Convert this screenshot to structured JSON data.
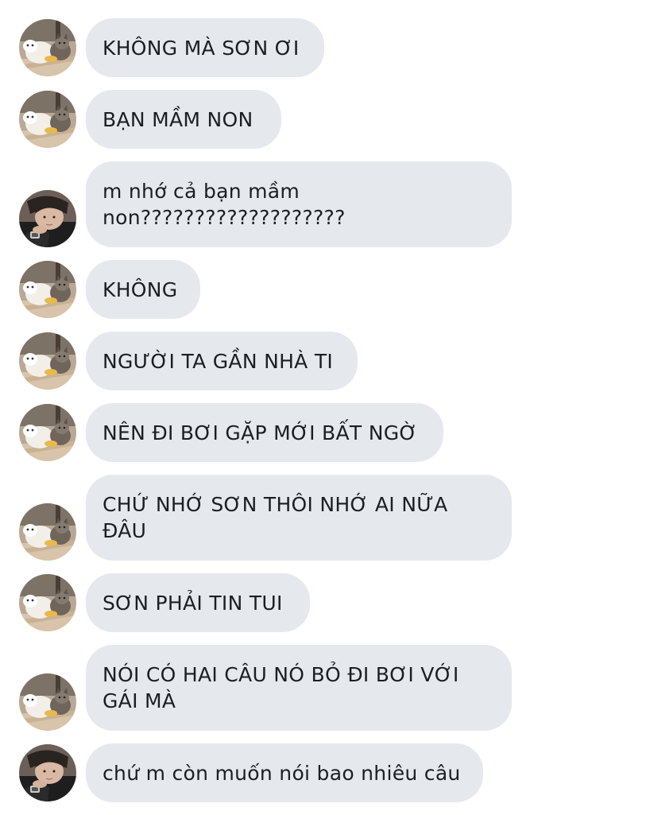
{
  "conversation": {
    "messages": [
      {
        "sender": "cat-user",
        "avatar_icon": "cat-avatar-icon",
        "text": "KHÔNG MÀ SƠN ƠI"
      },
      {
        "sender": "cat-user",
        "avatar_icon": "cat-avatar-icon",
        "text": "BẠN MẦM NON"
      },
      {
        "sender": "man-user",
        "avatar_icon": "man-avatar-icon",
        "text": "m nhớ cả bạn mầm\nnon???????????????????"
      },
      {
        "sender": "cat-user",
        "avatar_icon": "cat-avatar-icon",
        "text": "KHÔNG"
      },
      {
        "sender": "cat-user",
        "avatar_icon": "cat-avatar-icon",
        "text": "NGƯỜI TA GẦN NHÀ TI"
      },
      {
        "sender": "cat-user",
        "avatar_icon": "cat-avatar-icon",
        "text": "NÊN ĐI BƠI GẶP MỚI BẤT NGỜ"
      },
      {
        "sender": "cat-user",
        "avatar_icon": "cat-avatar-icon",
        "text": "CHỨ NHỚ SƠN THÔI NHỚ AI NỮA\nĐÂU"
      },
      {
        "sender": "cat-user",
        "avatar_icon": "cat-avatar-icon",
        "text": "SƠN PHẢI TIN TUI"
      },
      {
        "sender": "cat-user",
        "avatar_icon": "cat-avatar-icon",
        "text": "NÓI CÓ HAI CÂU NÓ BỎ ĐI BƠI VỚI\nGÁI MÀ"
      },
      {
        "sender": "man-user",
        "avatar_icon": "man-avatar-icon",
        "text": "chứ m còn muốn nói bao nhiêu câu"
      }
    ]
  },
  "colors": {
    "bubble_background": "#e5e9ee",
    "text": "#1c1e21",
    "page_background": "#ffffff"
  }
}
